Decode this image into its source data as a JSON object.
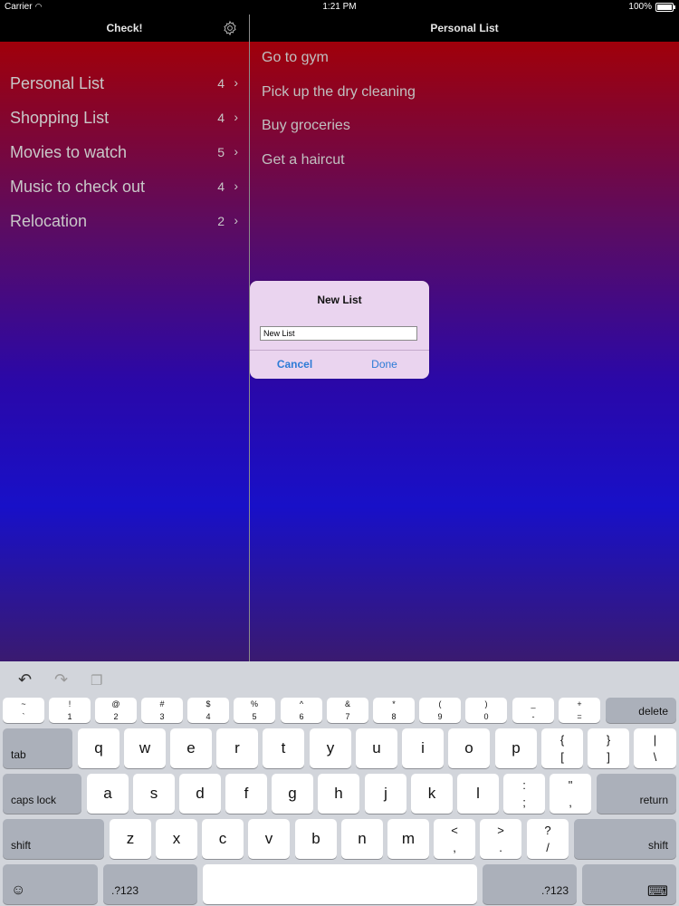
{
  "status_bar": {
    "carrier": "Carrier",
    "time": "1:21 PM",
    "battery": "100%"
  },
  "left_nav": {
    "title": "Check!"
  },
  "right_nav": {
    "title": "Personal List"
  },
  "lists": [
    {
      "name": "Personal List",
      "count": "4"
    },
    {
      "name": "Shopping List",
      "count": "4"
    },
    {
      "name": "Movies to watch",
      "count": "5"
    },
    {
      "name": "Music to check out",
      "count": "4"
    },
    {
      "name": "Relocation",
      "count": "2"
    }
  ],
  "items": [
    {
      "text": "Go to gym"
    },
    {
      "text": "Pick up the dry cleaning"
    },
    {
      "text": "Buy groceries"
    },
    {
      "text": "Get a haircut"
    }
  ],
  "dialog": {
    "title": "New List",
    "input_value": "New List",
    "cancel": "Cancel",
    "done": "Done"
  },
  "keyboard": {
    "number_row": [
      {
        "top": "~",
        "bot": "`"
      },
      {
        "top": "!",
        "bot": "1"
      },
      {
        "top": "@",
        "bot": "2"
      },
      {
        "top": "#",
        "bot": "3"
      },
      {
        "top": "$",
        "bot": "4"
      },
      {
        "top": "%",
        "bot": "5"
      },
      {
        "top": "^",
        "bot": "6"
      },
      {
        "top": "&",
        "bot": "7"
      },
      {
        "top": "*",
        "bot": "8"
      },
      {
        "top": "(",
        "bot": "9"
      },
      {
        "top": ")",
        "bot": "0"
      },
      {
        "top": "_",
        "bot": "-"
      },
      {
        "top": "+",
        "bot": "="
      }
    ],
    "delete": "delete",
    "tab": "tab",
    "row1": [
      "q",
      "w",
      "e",
      "r",
      "t",
      "y",
      "u",
      "i",
      "o",
      "p"
    ],
    "row1_extra": [
      {
        "top": "{",
        "bot": "["
      },
      {
        "top": "}",
        "bot": "]"
      },
      {
        "top": "|",
        "bot": "\\"
      }
    ],
    "caps": "caps lock",
    "row2": [
      "a",
      "s",
      "d",
      "f",
      "g",
      "h",
      "j",
      "k",
      "l"
    ],
    "row2_extra": [
      {
        "top": ":",
        "bot": ";"
      },
      {
        "top": "\"",
        "bot": ","
      }
    ],
    "return": "return",
    "shift": "shift",
    "row3": [
      "z",
      "x",
      "c",
      "v",
      "b",
      "n",
      "m"
    ],
    "row3_extra": [
      {
        "top": "<",
        "bot": ","
      },
      {
        "top": ">",
        "bot": "."
      },
      {
        "top": "?",
        "bot": "/"
      }
    ],
    "numbers_label": ".?123",
    "emoji": "☺",
    "undo": "↶",
    "redo": "↷",
    "paste": "❐",
    "hide_keyboard": "⌨"
  }
}
